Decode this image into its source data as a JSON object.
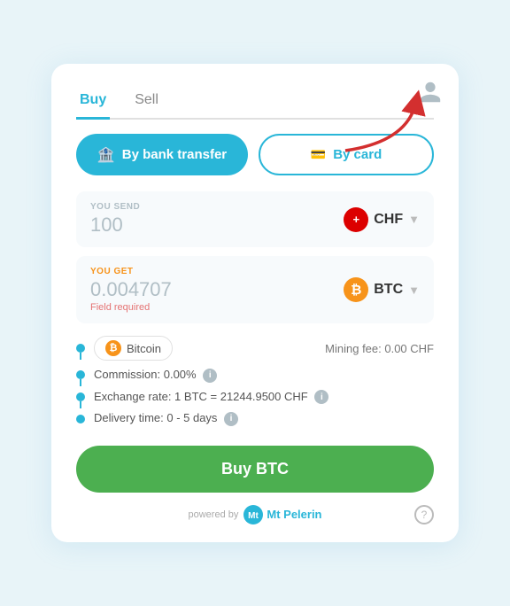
{
  "tabs": [
    {
      "id": "buy",
      "label": "Buy",
      "active": true
    },
    {
      "id": "sell",
      "label": "Sell",
      "active": false
    }
  ],
  "payment_methods": {
    "bank": {
      "label": "By bank transfer"
    },
    "card": {
      "label": "By card"
    }
  },
  "send": {
    "label": "YOU SEND",
    "value": "100",
    "currency": "CHF",
    "currency_symbol": "+"
  },
  "get": {
    "label": "YOU GET",
    "value": "0.004707",
    "field_required": "Field required",
    "currency": "BTC"
  },
  "bitcoin": {
    "name": "Bitcoin",
    "mining_fee": "Mining fee: 0.00 CHF"
  },
  "details": [
    {
      "label": "Commission: 0.00%",
      "has_info": true
    },
    {
      "label": "Exchange rate: 1 BTC = 21244.9500 CHF",
      "has_info": true
    },
    {
      "label": "Delivery time: 0 - 5 days",
      "has_info": true
    }
  ],
  "buy_button": "Buy BTC",
  "footer": {
    "powered_by": "powered by",
    "brand": "Mt\nPelerin"
  },
  "help": "?",
  "profile_icon": "person"
}
